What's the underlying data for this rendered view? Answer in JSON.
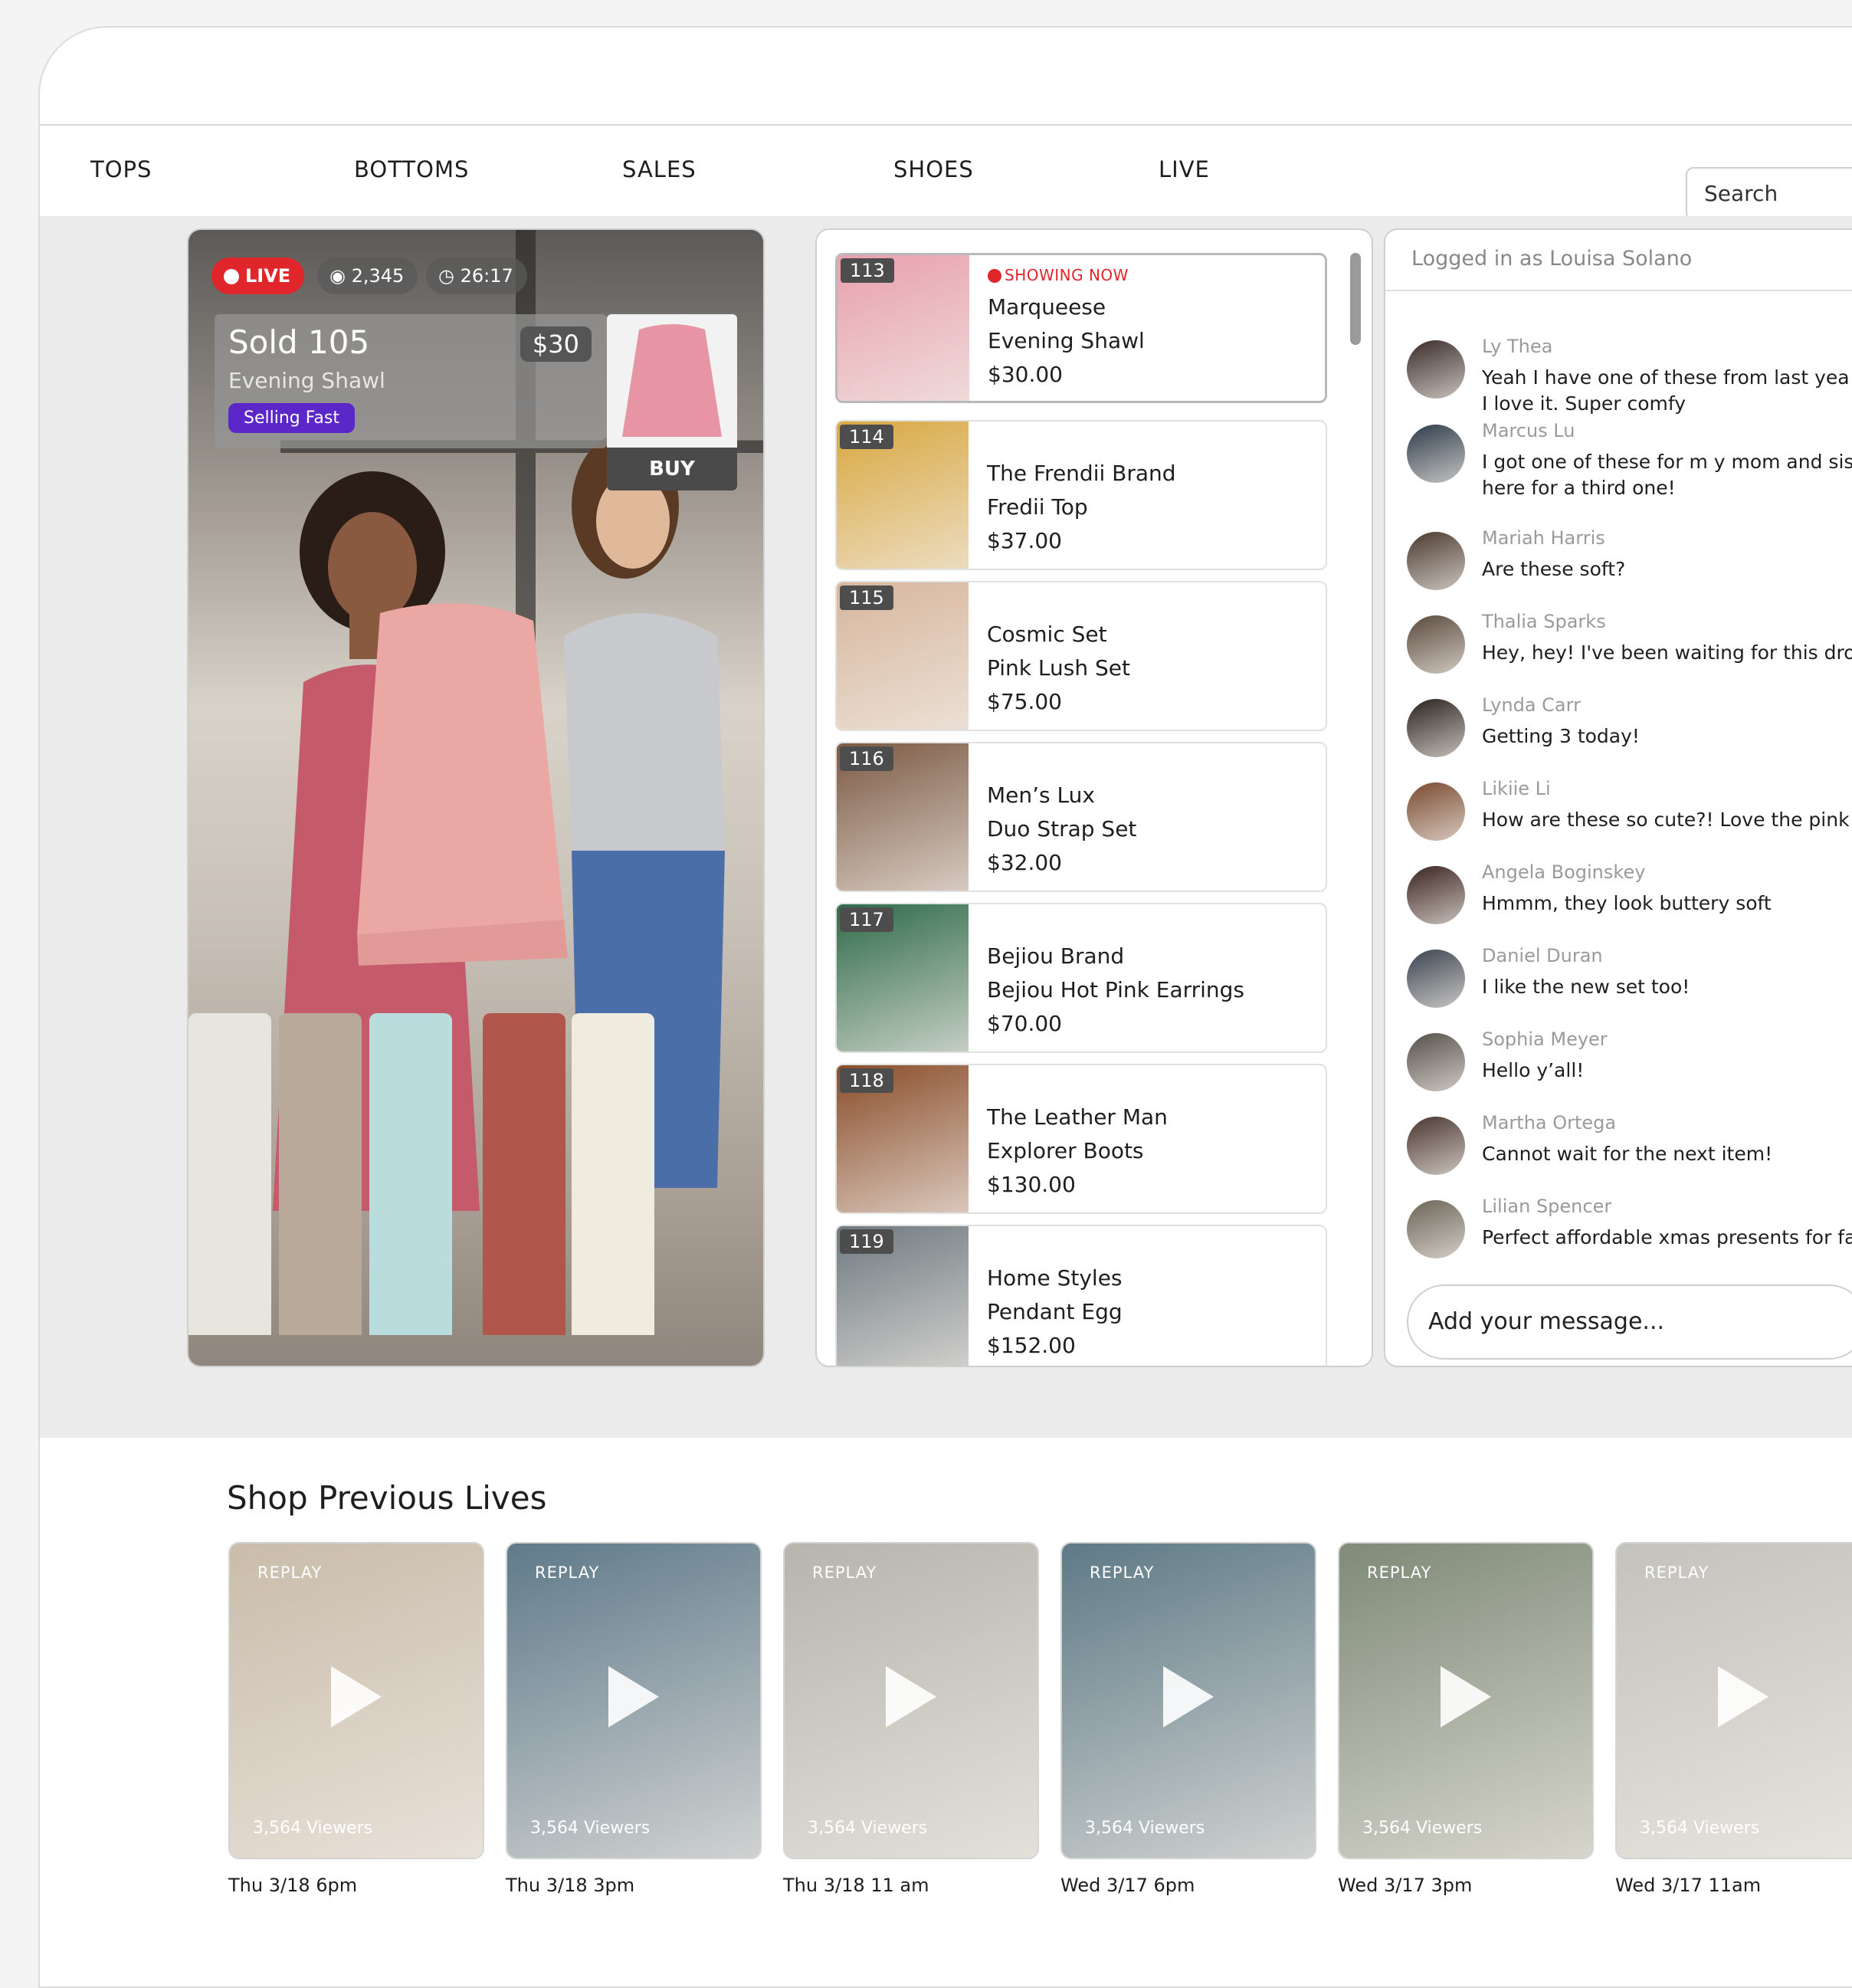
{
  "nav": {
    "items": [
      "TOPS",
      "BOTTOMS",
      "SALES",
      "SHOES",
      "LIVE"
    ],
    "search_placeholder": "Search"
  },
  "live": {
    "live_label": "LIVE",
    "viewers": "2,345",
    "timer": "26:17",
    "sold_title": "Sold 105",
    "sold_subtitle": "Evening Shawl",
    "price": "$30",
    "selling_fast": "Selling Fast",
    "buy_label": "BUY"
  },
  "products": [
    {
      "num": "113",
      "line1": "Marqueese",
      "line2": "Evening Shawl",
      "price": "$30.00",
      "showing": "SHOWING NOW",
      "color": "#e8a0ad"
    },
    {
      "num": "114",
      "line1": "The Frendii Brand",
      "line2": "Fredii Top",
      "price": "$37.00",
      "color": "#d9a840"
    },
    {
      "num": "115",
      "line1": "Cosmic Set",
      "line2": "Pink Lush Set",
      "price": "$75.00",
      "color": "#d7b69c"
    },
    {
      "num": "116",
      "line1": "Men’s Lux",
      "line2": "Duo Strap Set",
      "price": "$32.00",
      "color": "#7c5a44"
    },
    {
      "num": "117",
      "line1": "Bejiou Brand",
      "line2": "Bejiou Hot Pink Earrings",
      "price": "$70.00",
      "color": "#2f6b4a"
    },
    {
      "num": "118",
      "line1": "The Leather Man",
      "line2": "Explorer Boots",
      "price": "$130.00",
      "color": "#8a4d2a"
    },
    {
      "num": "119",
      "line1": "Home Styles",
      "line2": "Pendant Egg",
      "price": "$152.00",
      "color": "#6f7a80"
    }
  ],
  "chat": {
    "logged_in": "Logged in as Louisa Solano",
    "messages": [
      {
        "name": "Ly Thea",
        "text": "Yeah I have one of these from last yea",
        "text2": "I love it. Super comfy",
        "color": "#3a2c28"
      },
      {
        "name": "Marcus Lu",
        "text": "I got one of these for m y mom and sis",
        "text2": "here for a third one!",
        "color": "#2e3c4a"
      },
      {
        "name": "Mariah Harris",
        "text": "Are these soft?",
        "color": "#4a3a30"
      },
      {
        "name": "Thalia Sparks",
        "text": "Hey, hey! I've been waiting for this drop",
        "color": "#5a4a3c"
      },
      {
        "name": "Lynda Carr",
        "text": "Getting 3 today!",
        "color": "#2a221e"
      },
      {
        "name": "Likiie Li",
        "text": "How are these so cute?! Love the pink o",
        "color": "#7a4a30"
      },
      {
        "name": "Angela Boginskey",
        "text": "Hmmm, they look buttery soft",
        "color": "#3a2420"
      },
      {
        "name": "Daniel Duran",
        "text": "I like the new set too!",
        "color": "#3c4450"
      },
      {
        "name": "Sophia Meyer",
        "text": "Hello y’all!",
        "color": "#56504a"
      },
      {
        "name": "Martha Ortega",
        "text": "Cannot wait for the next item!",
        "color": "#4a3630"
      },
      {
        "name": "Lilian Spencer",
        "text": "Perfect affordable xmas presents for fa",
        "color": "#6a6458"
      }
    ],
    "composer_placeholder": "Add your message..."
  },
  "previous": {
    "title": "Shop Previous Lives",
    "replay_label": "REPLAY",
    "cards": [
      {
        "viewers": "3,564 Viewers",
        "date": "Thu 3/18 6pm",
        "color": "#c9bcaa"
      },
      {
        "viewers": "3,564 Viewers",
        "date": "Thu 3/18 3pm",
        "color": "#5f7a8a"
      },
      {
        "viewers": "3,564 Viewers",
        "date": "Thu 3/18 11 am",
        "color": "#b7b4ae"
      },
      {
        "viewers": "3,564 Viewers",
        "date": "Wed 3/17 6pm",
        "color": "#5e7a86"
      },
      {
        "viewers": "3,564 Viewers",
        "date": "Wed 3/17 3pm",
        "color": "#7f8a78"
      },
      {
        "viewers": "3,564 Viewers",
        "date": "Wed 3/17 11am",
        "color": "#c4c2bd"
      }
    ]
  }
}
